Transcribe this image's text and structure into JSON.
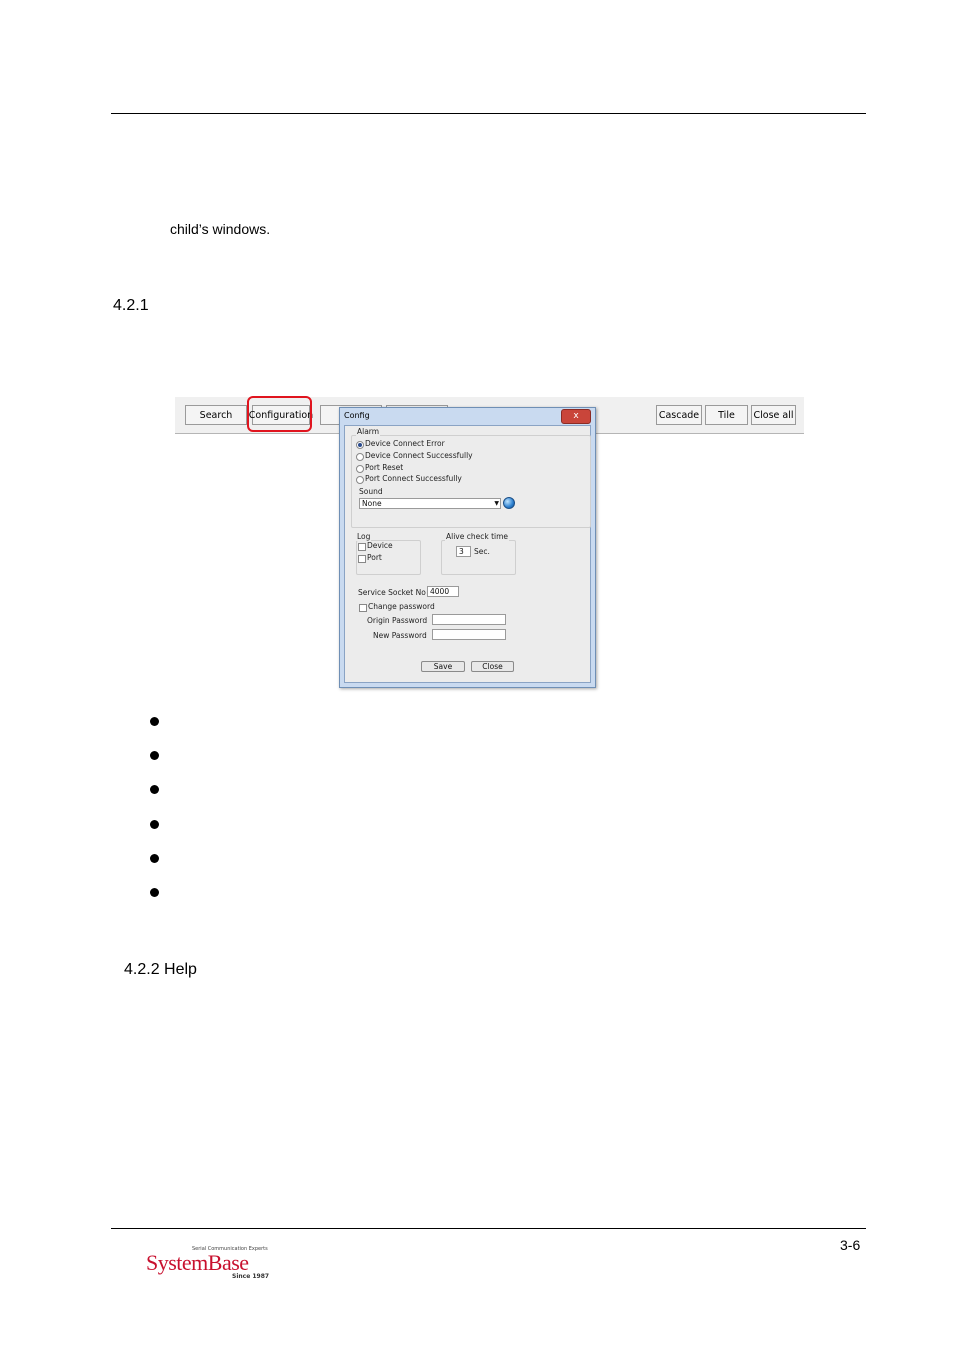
{
  "page": {
    "intro_text": "child’s windows.",
    "section_heading": "4.2.1",
    "help_heading": "4.2.2 Help",
    "page_number": "3-6"
  },
  "toolbar": {
    "search_label": "Search",
    "configuration_label": "Configuration",
    "cascade_label": "Cascade",
    "tile_label": "Tile",
    "close_all_label": "Close all"
  },
  "config_dialog": {
    "title": "Config",
    "close_glyph": "x",
    "alarm_group": "Alarm",
    "alarm_options": [
      {
        "label": "Device Connect Error",
        "selected": true
      },
      {
        "label": "Device Connect Successfully",
        "selected": false
      },
      {
        "label": "Port Reset",
        "selected": false
      },
      {
        "label": "Port Connect Successfully",
        "selected": false
      }
    ],
    "sound_label": "Sound",
    "sound_value": "None",
    "log_group": "Log",
    "log_device": "Device",
    "log_port": "Port",
    "alive_group": "Alive check time",
    "alive_value": "3",
    "alive_unit": "Sec.",
    "socket_label": "Service Socket No",
    "socket_value": "4000",
    "change_password": "Change password",
    "origin_password": "Origin Password",
    "new_password": "New Password",
    "save_label": "Save",
    "close_label": "Close"
  },
  "logo": {
    "tagline": "Serial Communication Experts",
    "name": "SystemBase",
    "since": "Since 1987",
    "brand_color": "#c8102e"
  },
  "colors": {
    "highlight": "#e0141e"
  }
}
